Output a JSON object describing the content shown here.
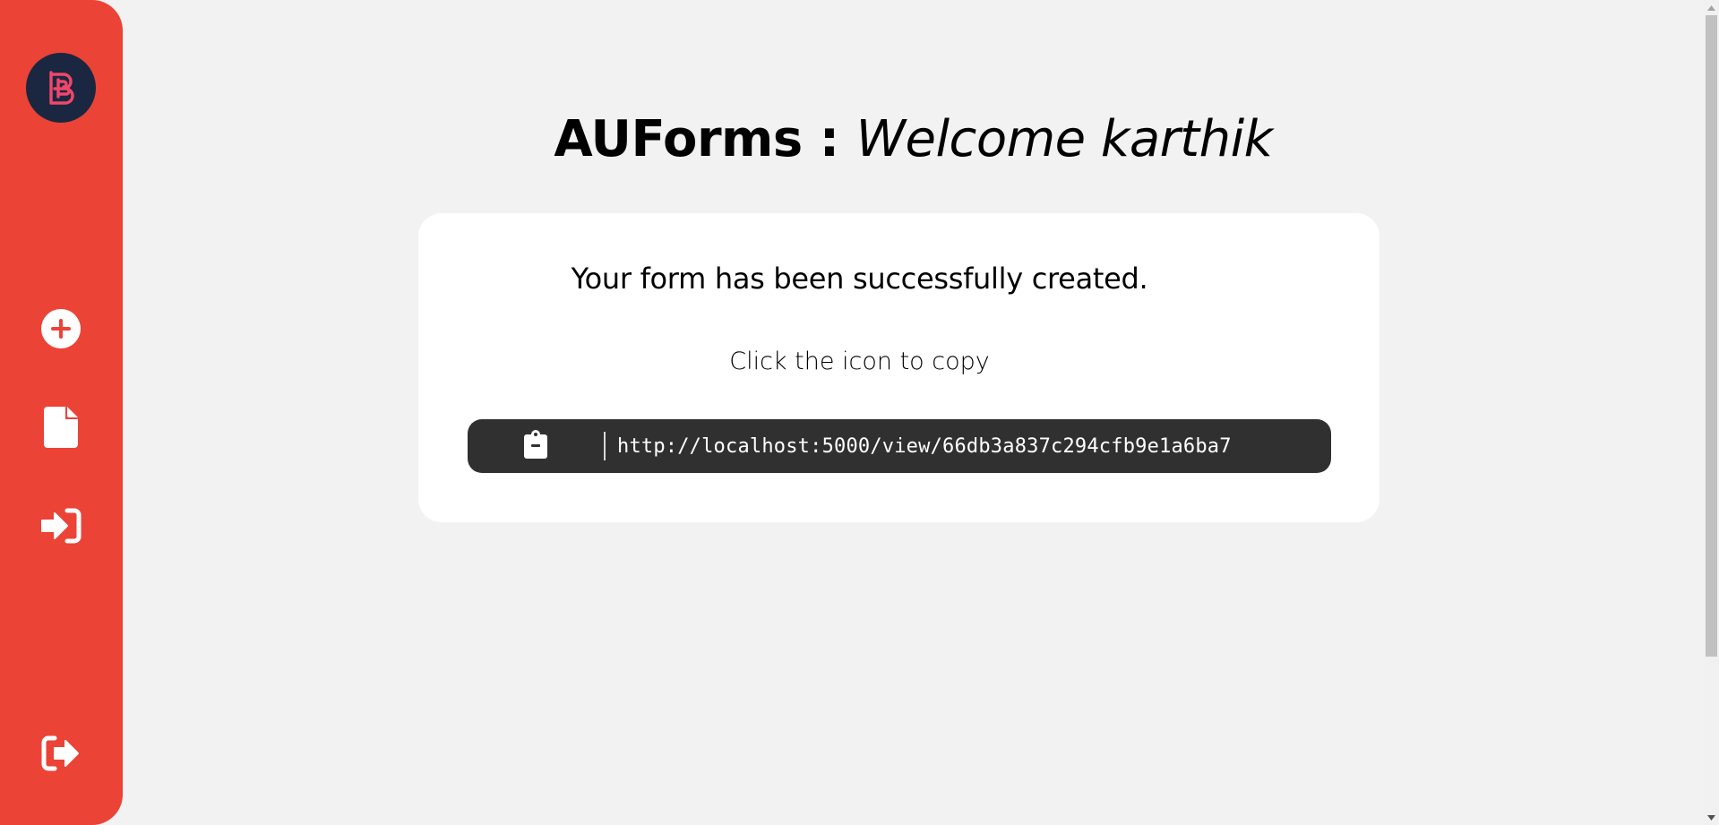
{
  "app": {
    "brand": "AUForms",
    "separator": ":",
    "welcome": "Welcome karthik"
  },
  "sidebar": {
    "logo_icon": "brand-logo-icon",
    "items": [
      {
        "name": "create-form",
        "icon": "plus-circle-icon"
      },
      {
        "name": "my-forms",
        "icon": "document-icon"
      },
      {
        "name": "sign-in",
        "icon": "sign-in-icon"
      }
    ],
    "logout_icon": "sign-out-icon"
  },
  "card": {
    "heading": "Your form has been successfully created.",
    "subtext": "Click the icon to copy",
    "copy_icon": "clipboard-icon",
    "url": "http://localhost:5000/view/66db3a837c294cfb9e1a6ba7"
  },
  "colors": {
    "sidebar": "#ec4337",
    "logo_bg": "#1b2740",
    "logo_accent": "#f0476a",
    "background": "#f2f2f2",
    "card": "#ffffff",
    "copy_bar": "#303030"
  }
}
